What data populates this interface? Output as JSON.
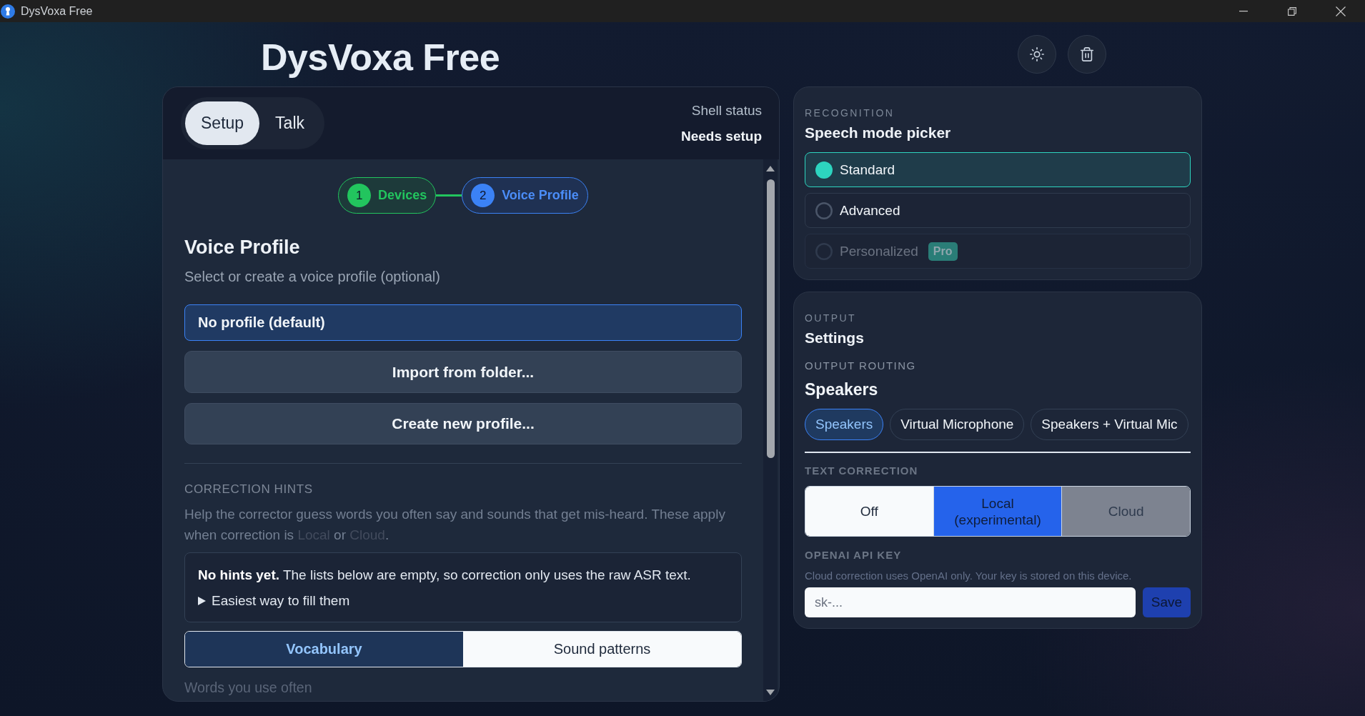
{
  "window": {
    "title": "DysVoxa Free"
  },
  "header": {
    "title": "DysVoxa Free"
  },
  "shell": {
    "tabs": [
      {
        "label": "Setup",
        "selected": true
      },
      {
        "label": "Talk",
        "selected": false
      }
    ],
    "status_label": "Shell status",
    "status_value": "Needs setup"
  },
  "stepper": [
    {
      "number": "1",
      "label": "Devices",
      "completed": true,
      "selected": false
    },
    {
      "number": "2",
      "label": "Voice Profile",
      "completed": false,
      "selected": true
    }
  ],
  "voice_profile": {
    "title": "Voice Profile",
    "subtitle": "Select or create a voice profile (optional)",
    "profiles": [
      {
        "label": "No profile (default)",
        "selected": true
      }
    ],
    "actions": [
      "Import from folder...",
      "Create new profile..."
    ]
  },
  "correction_hints": {
    "heading": "CORRECTION HINTS",
    "description": [
      {
        "text": "Help the corrector guess words you often say and sounds that get mis-heard. These apply when correction is ",
        "muted": false
      },
      {
        "text": "Local",
        "muted": true
      },
      {
        "text": " or ",
        "muted": false
      },
      {
        "text": "Cloud",
        "muted": true
      },
      {
        "text": ".",
        "muted": false
      }
    ],
    "notice": "**No hints yet.** The lists below are empty, so correction only uses the raw ASR text.",
    "disclosure": {
      "label": "Easiest way to fill them",
      "expanded": false
    },
    "tabs": [
      {
        "label": "Vocabulary",
        "selected": true
      },
      {
        "label": "Sound patterns",
        "selected": false
      }
    ],
    "field_label": "Words you use often"
  },
  "recognition": {
    "eyebrow": "RECOGNITION",
    "title": "Speech mode picker",
    "modes": [
      {
        "label": "Standard",
        "selected": true,
        "disabled": false
      },
      {
        "label": "Advanced",
        "selected": false,
        "disabled": false
      },
      {
        "label": "Personalized",
        "selected": false,
        "disabled": true,
        "badge": "Pro"
      }
    ]
  },
  "output": {
    "eyebrow": "OUTPUT",
    "title": "Settings",
    "routing_label": "OUTPUT ROUTING",
    "routing_value": "Speakers",
    "routes": [
      {
        "label": "Speakers",
        "selected": true
      },
      {
        "label": "Virtual Microphone",
        "selected": false
      },
      {
        "label": "Speakers + Virtual Mic",
        "selected": false
      }
    ],
    "correction_label": "TEXT CORRECTION",
    "correction_modes": [
      {
        "label": "Off",
        "selected": false,
        "disabled": false
      },
      {
        "label": "Local (experimental)",
        "selected": true,
        "disabled": false
      },
      {
        "label": "Cloud",
        "selected": false,
        "disabled": true
      }
    ],
    "api_key": {
      "label": "OPENAI API KEY",
      "note": "Cloud correction uses OpenAI only. Your key is stored on this device.",
      "placeholder": "sk-...",
      "button": "Save"
    }
  }
}
